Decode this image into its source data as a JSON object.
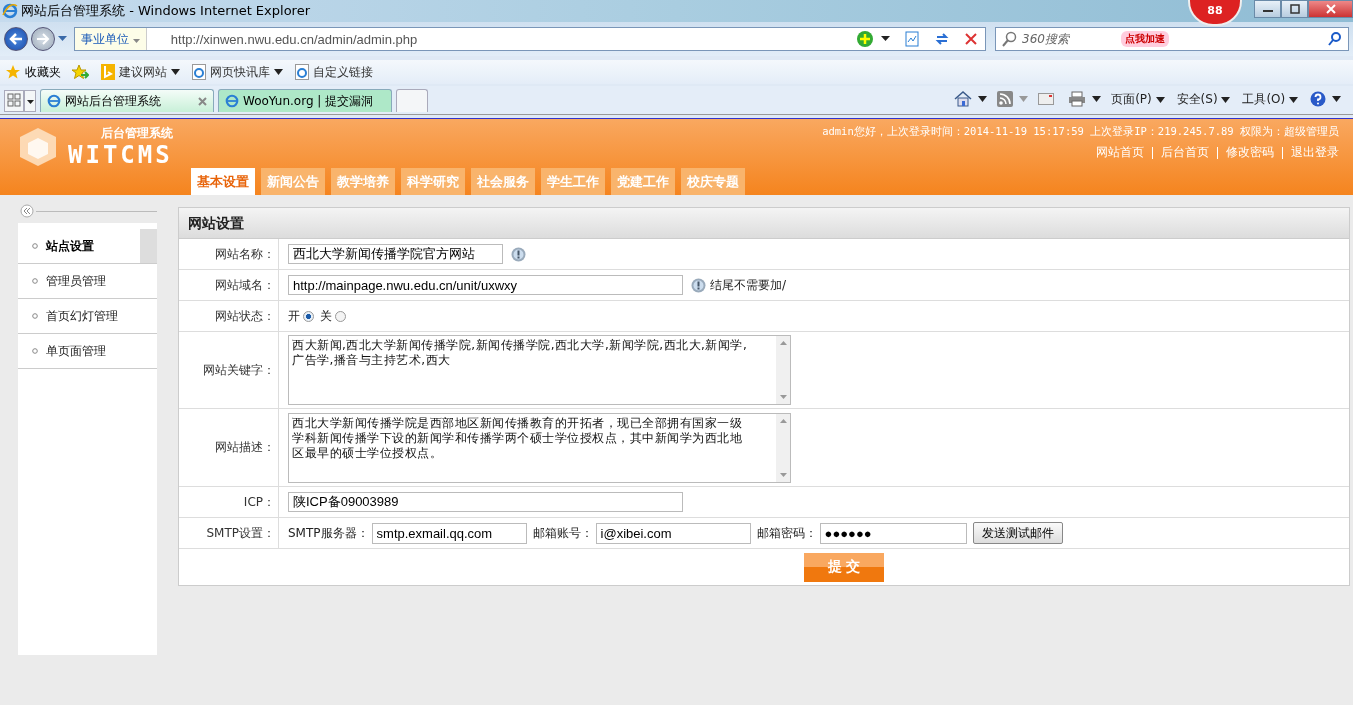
{
  "window": {
    "title": "网站后台管理系统 - Windows Internet Explorer"
  },
  "browser": {
    "address_dropdown": "事业单位",
    "url": "http://xinwen.nwu.edu.cn/admin/admin.php",
    "search_placeholder": "360搜索",
    "badge_count": "88",
    "badge_label": "点我加速",
    "favorites": [
      {
        "label": "收藏夹",
        "kind": "star"
      },
      {
        "label": "建议网站",
        "kind": "bing"
      },
      {
        "label": "网页快讯库",
        "kind": "ie"
      },
      {
        "label": "自定义链接",
        "kind": "ie"
      }
    ],
    "tabs": [
      {
        "label": "网站后台管理系统",
        "selected": true
      },
      {
        "label": "WooYun.org | 提交漏洞",
        "selected": false
      }
    ],
    "commands": [
      "页面(P)",
      "安全(S)",
      "工具(O)"
    ]
  },
  "header": {
    "logo_subtitle": "后台管理系统",
    "logo_name": "WITCMS",
    "login_info": "admin您好，上次登录时间：2014-11-19 15:17:59 上次登录IP：219.245.7.89 权限为：超级管理员",
    "links": [
      "网站首页",
      "后台首页",
      "修改密码",
      "退出登录"
    ],
    "nav": [
      {
        "label": "基本设置",
        "selected": true
      },
      {
        "label": "新闻公告",
        "selected": false
      },
      {
        "label": "教学培养",
        "selected": false
      },
      {
        "label": "科学研究",
        "selected": false
      },
      {
        "label": "社会服务",
        "selected": false
      },
      {
        "label": "学生工作",
        "selected": false
      },
      {
        "label": "党建工作",
        "selected": false
      },
      {
        "label": "校庆专题",
        "selected": false
      }
    ]
  },
  "sidebar": {
    "items": [
      {
        "label": "站点设置",
        "selected": true
      },
      {
        "label": "管理员管理",
        "selected": false
      },
      {
        "label": "首页幻灯管理",
        "selected": false
      },
      {
        "label": "单页面管理",
        "selected": false
      }
    ]
  },
  "form": {
    "title": "网站设置",
    "rows": [
      {
        "kind": "text",
        "label": "网站名称：",
        "value": "西北大学新闻传播学院官方网站",
        "info": true
      },
      {
        "kind": "text",
        "label": "网站域名：",
        "value": "http://mainpage.nwu.edu.cn/unit/uxwxy",
        "info": true,
        "hint": "结尾不需要加/"
      },
      {
        "kind": "radio",
        "label": "网站状态：",
        "options": [
          {
            "label": "开",
            "selected": true
          },
          {
            "label": "关",
            "selected": false
          }
        ]
      },
      {
        "kind": "textarea",
        "label": "网站关键字：",
        "value": "西大新闻,西北大学新闻传播学院,新闻传播学院,西北大学,新闻学院,西北大,新闻学,广告学,播音与主持艺术,西大"
      },
      {
        "kind": "textarea",
        "label": "网站描述：",
        "value": "西北大学新闻传播学院是西部地区新闻传播教育的开拓者，现已全部拥有国家一级学科新闻传播学下设的新闻学和传播学两个硕士学位授权点，其中新闻学为西北地区最早的硕士学位授权点。"
      },
      {
        "kind": "text",
        "label": "ICP：",
        "value": "陕ICP备09003989",
        "info": false
      },
      {
        "kind": "smtp",
        "label": "SMTP设置：",
        "fields": [
          {
            "label": "SMTP服务器：",
            "value": "smtp.exmail.qq.com"
          },
          {
            "label": "邮箱账号：",
            "value": "i@xibei.com"
          },
          {
            "label": "邮箱密码：",
            "value": "●●●●●●"
          }
        ],
        "button": "发送测试邮件"
      }
    ],
    "submit": "提 交"
  }
}
